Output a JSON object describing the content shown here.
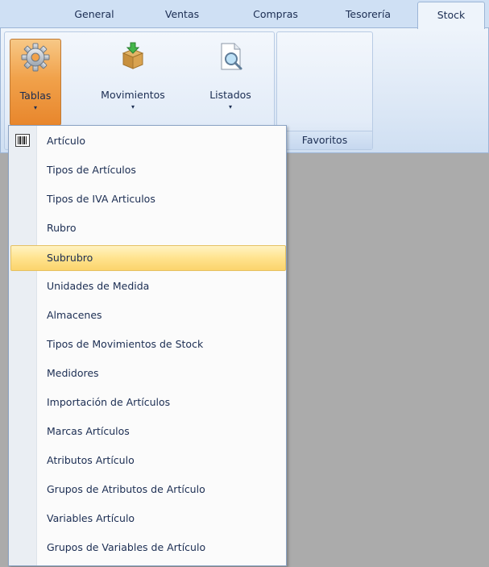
{
  "tabs": [
    {
      "label": "General",
      "active": false
    },
    {
      "label": "Ventas",
      "active": false
    },
    {
      "label": "Compras",
      "active": false
    },
    {
      "label": "Tesorería",
      "active": false
    },
    {
      "label": "Stock",
      "active": true
    }
  ],
  "ribbon": {
    "buttons": [
      {
        "label": "Tablas",
        "icon": "gear-icon",
        "arrow": "▾"
      },
      {
        "label": "Movimientos",
        "icon": "box-download-icon",
        "arrow": "▾"
      },
      {
        "label": "Listados",
        "icon": "document-search-icon",
        "arrow": "▾"
      }
    ],
    "favorites_group_label": "Favoritos"
  },
  "menu": {
    "items": [
      {
        "label": "Artículo",
        "icon": "barcode-icon"
      },
      {
        "label": "Tipos de Artículos"
      },
      {
        "label": "Tipos de IVA Articulos"
      },
      {
        "label": "Rubro"
      },
      {
        "label": "Subrubro",
        "highlighted": true
      },
      {
        "label": "Unidades de Medida"
      },
      {
        "label": "Almacenes"
      },
      {
        "label": "Tipos de Movimientos de Stock"
      },
      {
        "label": "Medidores"
      },
      {
        "label": "Importación de Artículos"
      },
      {
        "label": "Marcas Artículos"
      },
      {
        "label": "Atributos Artículo"
      },
      {
        "label": "Grupos de Atributos de Artículo"
      },
      {
        "label": "Variables Artículo"
      },
      {
        "label": "Grupos de Variables de Artículo"
      }
    ]
  },
  "colors": {
    "accent_pressed": "#f1a24b",
    "highlight": "#ffe38e",
    "workspace": "#ababab"
  }
}
